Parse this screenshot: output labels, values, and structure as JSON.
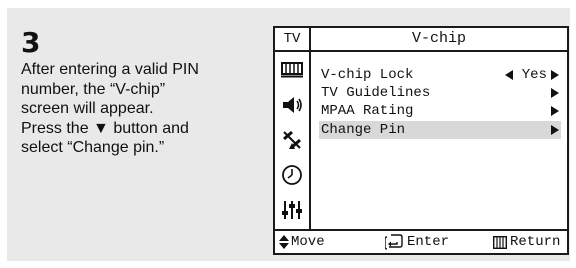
{
  "step": {
    "number": "3",
    "lines": [
      "After entering a valid PIN",
      "number, the “V-chip”",
      "screen will appear.",
      "Press the ▼ button and",
      "select “Change pin.”"
    ]
  },
  "tv_menu": {
    "source_label": "TV",
    "title": "V-chip",
    "items": [
      {
        "label": "V-chip Lock",
        "value": "Yes",
        "has_left_arrow": true,
        "has_right_arrow": true,
        "selected": false
      },
      {
        "label": "TV Guidelines",
        "value": "",
        "has_left_arrow": false,
        "has_right_arrow": true,
        "selected": false
      },
      {
        "label": "MPAA Rating",
        "value": "",
        "has_left_arrow": false,
        "has_right_arrow": true,
        "selected": false
      },
      {
        "label": "Change Pin",
        "value": "",
        "has_left_arrow": false,
        "has_right_arrow": true,
        "selected": true
      }
    ],
    "side_icons": [
      "picture-icon",
      "sound-icon",
      "channel-antenna-icon",
      "clock-icon",
      "setup-sliders-icon"
    ],
    "active_icon": "setup-sliders-icon",
    "footer": {
      "move": "Move",
      "enter": "Enter",
      "return": "Return"
    }
  },
  "colors": {
    "panel_bg": "#e9e9e9",
    "highlight": "#d8d8d8",
    "text": "#111111"
  }
}
